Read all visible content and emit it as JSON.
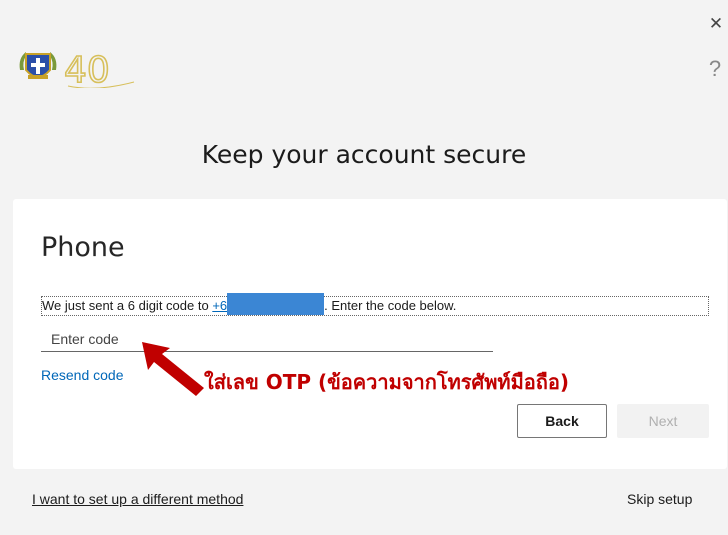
{
  "window": {
    "close_glyph": "✕",
    "help_glyph": "?"
  },
  "logo": {
    "text": "40",
    "icons": [
      "school-crest-icon",
      "anniversary-40-logo"
    ]
  },
  "header": {
    "title": "Keep your account secure"
  },
  "section": {
    "title": "Phone"
  },
  "message": {
    "prefix": "We just sent a 6 digit code to ",
    "phone": "+6",
    "suffix": ". Enter the code below."
  },
  "code_input": {
    "placeholder": "Enter code",
    "value": ""
  },
  "resend": {
    "label": "Resend code"
  },
  "annotation": {
    "text": "ใส่เลข OTP (ข้อความจากโทรศัพท์มือถือ)",
    "color": "#c00000"
  },
  "buttons": {
    "back": "Back",
    "next": "Next"
  },
  "footer": {
    "alt_method": "I want to set up a different method",
    "skip": "Skip setup"
  },
  "colors": {
    "link": "#0067b8",
    "annotation": "#c00000",
    "redaction": "#3b86d4"
  }
}
